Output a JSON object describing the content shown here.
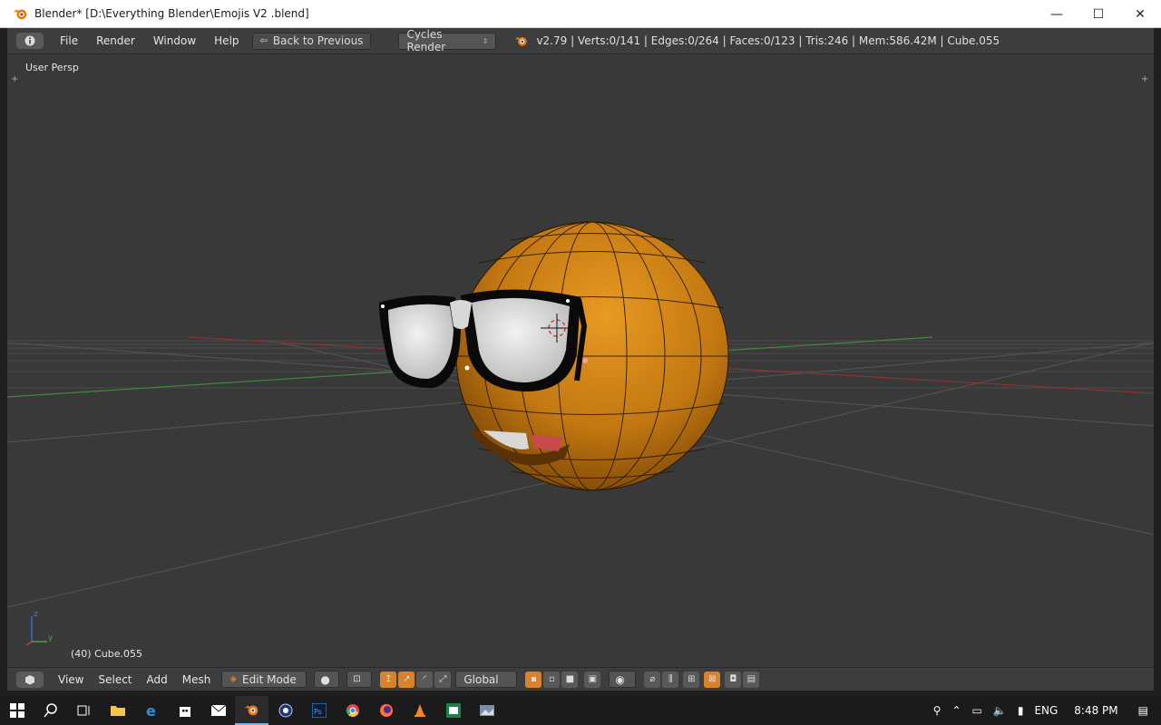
{
  "window": {
    "title": "Blender* [D:\\Everything Blender\\Emojis V2 .blend]",
    "minimize": "—",
    "maximize": "☐",
    "close": "✕"
  },
  "infobar": {
    "menus": [
      "File",
      "Render",
      "Window",
      "Help"
    ],
    "back_label": "Back to Previous",
    "engine": "Cycles Render",
    "stats": "v2.79 | Verts:0/141 | Edges:0/264 | Faces:0/123 | Tris:246 | Mem:586.42M | Cube.055"
  },
  "viewport": {
    "view_label": "User Persp",
    "object_label": "(40) Cube.055",
    "axis_z": "z",
    "axis_y": "y"
  },
  "view3d_header": {
    "menus": [
      "View",
      "Select",
      "Add",
      "Mesh"
    ],
    "mode": "Edit Mode",
    "orientation": "Global"
  },
  "taskbar": {
    "language": "ENG",
    "time": "8:48 PM"
  },
  "colors": {
    "accent": "#d9822b",
    "viewport_bg": "#393939",
    "header_bg": "#3d3d3d"
  }
}
